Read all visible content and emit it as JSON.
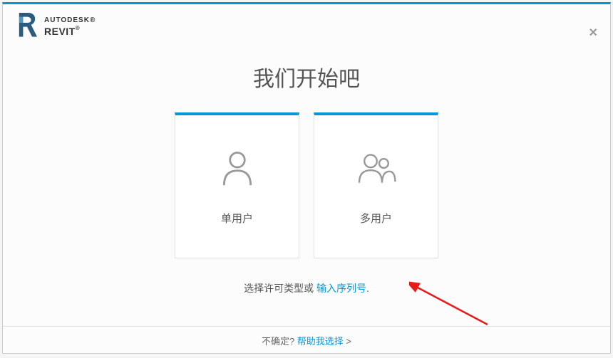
{
  "header": {
    "brand": "AUTODESK",
    "product": "REVIT",
    "brand_suffix": "®",
    "product_suffix": "®"
  },
  "main": {
    "title": "我们开始吧",
    "cards": [
      {
        "label": "单用户",
        "icon": "single-user"
      },
      {
        "label": "多用户",
        "icon": "multi-user"
      }
    ],
    "hint_prefix": "选择许可类型或 ",
    "hint_link": "输入序列号",
    "hint_suffix": "."
  },
  "footer": {
    "prefix": "不确定? ",
    "link": "帮助我选择",
    "suffix": " >"
  }
}
